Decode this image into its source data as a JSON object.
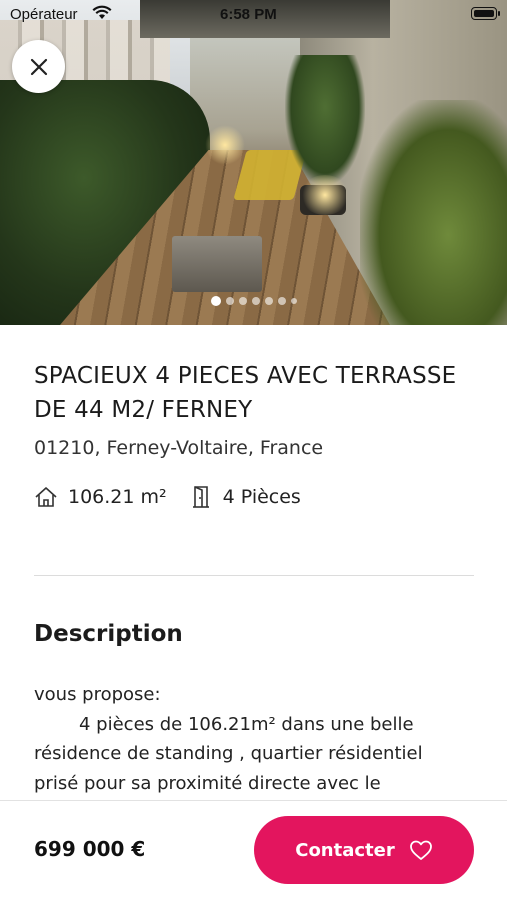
{
  "status_bar": {
    "carrier": "Opérateur",
    "time": "6:58 PM",
    "wifi_icon": "wifi-icon",
    "battery_icon": "battery-icon"
  },
  "gallery": {
    "image_count": 7,
    "active_index": 0,
    "close_icon": "close-icon"
  },
  "listing": {
    "title": "SPACIEUX 4 PIECES AVEC TERRASSE DE 44 M2/ FERNEY",
    "address": "01210, Ferney-Voltaire, France",
    "area": "106.21 m²",
    "rooms": "4 Pièces",
    "area_icon": "house-icon",
    "rooms_icon": "door-icon"
  },
  "description": {
    "heading": "Description",
    "lines": [
      "vous propose:",
      "4 pièces de 106.21m² dans une belle",
      "résidence de standing , quartier résidentiel",
      "prisé pour sa proximité directe avec le"
    ]
  },
  "footer": {
    "price": "699 000 €",
    "contact_label": "Contacter",
    "contact_icon": "heart-icon"
  },
  "colors": {
    "accent": "#e3155e",
    "text": "#222222",
    "divider": "#dcdcdc"
  }
}
